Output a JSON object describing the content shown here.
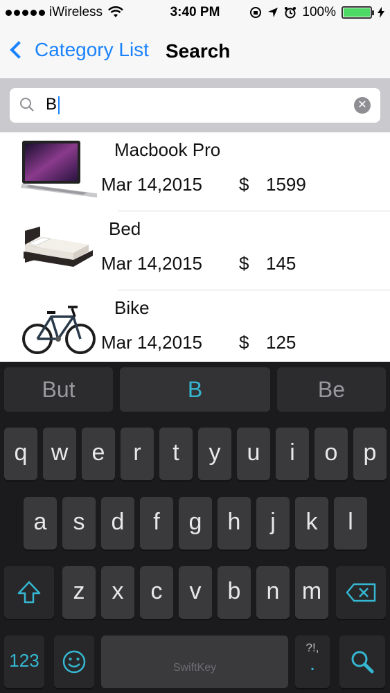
{
  "status_bar": {
    "carrier": "iWireless",
    "time": "3:40 PM",
    "battery": "100%"
  },
  "nav": {
    "back_label": "Category List",
    "title": "Search"
  },
  "search": {
    "query": "B"
  },
  "results": [
    {
      "name": "Macbook Pro",
      "date": "Mar 14,2015",
      "currency": "$",
      "price": "1599",
      "image": "laptop"
    },
    {
      "name": "Bed",
      "date": "Mar 14,2015",
      "currency": "$",
      "price": "145",
      "image": "bed"
    },
    {
      "name": "Bike",
      "date": "Mar 14,2015",
      "currency": "$",
      "price": "125",
      "image": "bicycle"
    }
  ],
  "keyboard": {
    "suggestions": [
      "But",
      "B",
      "Be"
    ],
    "row1": [
      "q",
      "w",
      "e",
      "r",
      "t",
      "y",
      "u",
      "i",
      "o",
      "p"
    ],
    "row2": [
      "a",
      "s",
      "d",
      "f",
      "g",
      "h",
      "j",
      "k",
      "l"
    ],
    "row3": [
      "z",
      "x",
      "c",
      "v",
      "b",
      "n",
      "m"
    ],
    "numbers_label": "123",
    "punct_label": "?!,",
    "punct_dot": ".",
    "space_brand": "SwiftKey"
  },
  "colors": {
    "ios_blue": "#1a82fb",
    "keyboard_accent": "#35b7d1",
    "battery_green": "#4cd964"
  }
}
